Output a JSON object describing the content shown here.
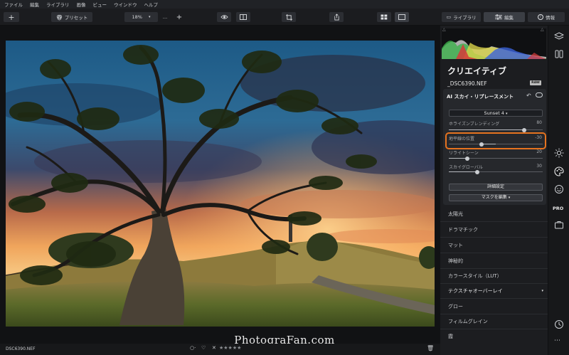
{
  "menu": [
    "ファイル",
    "編集",
    "ライブラリ",
    "画像",
    "ビュー",
    "ウインドウ",
    "ヘルプ"
  ],
  "toolbar": {
    "preset_label": "プリセット",
    "zoom_value": "18%",
    "library_tab": "ライブラリ",
    "edit_tab": "編集",
    "info_tab": "情報"
  },
  "panel": {
    "title": "クリエイティブ",
    "filename": "_DSC6390.NEF",
    "raw_badge": "RAW",
    "tool_name": "AI スカイ・リプレースメント",
    "sky_select": "Sunset 4",
    "sliders": [
      {
        "label": "ホライズンブレンディング",
        "value": "80",
        "pos": 0.8
      },
      {
        "label": "地平線の位置",
        "value": "-30",
        "pos": 0.35,
        "center": 0.5
      },
      {
        "label": "リライトシーン",
        "value": "20",
        "pos": 0.2
      },
      {
        "label": "スカイグローバル",
        "value": "30",
        "pos": 0.3
      }
    ],
    "advanced_button": "詳細設定",
    "mask_button": "マスクを編集",
    "presets": [
      "太陽光",
      "ドラマチック",
      "マット",
      "神秘的",
      "カラースタイル（LUT）",
      "テクスチャオーバーレイ",
      "グロー",
      "フィルムグレイン",
      "霞"
    ]
  },
  "bottom": {
    "filename": "DSC6390.NEF",
    "rating_stars": "★★★★★"
  },
  "watermark": "PhotograFan.com",
  "colors": {
    "accent_highlight": "#e6731f",
    "panel_bg": "#1c1d20",
    "card_bg": "#26282c"
  }
}
